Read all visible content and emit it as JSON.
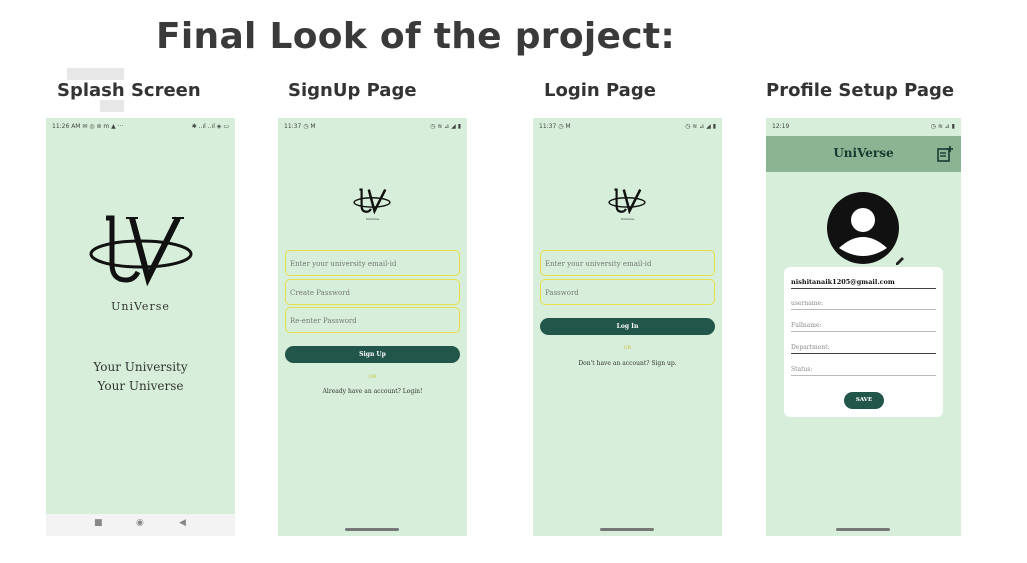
{
  "slide": {
    "title": "Final Look of the project:",
    "panels": {
      "splash": "Splash Screen",
      "signup": "SignUp Page",
      "login": "Login Page",
      "profile": "Profile Setup Page"
    }
  },
  "splash": {
    "status_time": "11:26 AM ✉ ◎ ⊚ m ▲ ···",
    "status_right": "✱ ..ıl ..ıl ◈ ▭",
    "brand": "UniVerse",
    "tagline_1": "Your University",
    "tagline_2": "Your Universe",
    "nav": {
      "recent": "■",
      "home": "◉",
      "back": "◀"
    }
  },
  "signup": {
    "status_time": "11:37 ◷ M",
    "status_right": "◷ ≋ ⊿ ◢ ▮",
    "brand_caption": "UniVerse",
    "fields": [
      "Enter your university email-id",
      "Create Password",
      "Re-enter Password"
    ],
    "button": "Sign Up",
    "or": "OR",
    "link": "Already have an account? Login!"
  },
  "login": {
    "status_time": "11:37 ◷ M",
    "status_right": "◷ ≋ ⊿ ◢ ▮",
    "brand_caption": "UniVerse",
    "fields": [
      "Enter your university email-id",
      "Password"
    ],
    "button": "Log In",
    "or": "OR",
    "link": "Don't have an account? Sign up."
  },
  "profile": {
    "status_time": "12:19",
    "status_right": "◷ ≋ ⊿ ▮",
    "app_title": "UniVerse",
    "email": "nishitanaik1205@gmail.com",
    "fields": [
      "username:",
      "Fullname:",
      "Department:",
      "Status:"
    ],
    "save": "SAVE"
  },
  "colors": {
    "phone_bg": "#d7efda",
    "button": "#23564a",
    "appbar": "#8bb592",
    "field_border": "#e6df4a"
  },
  "icons": [
    "universe-logo",
    "add-note-icon",
    "avatar-icon",
    "edit-pencil-icon"
  ]
}
